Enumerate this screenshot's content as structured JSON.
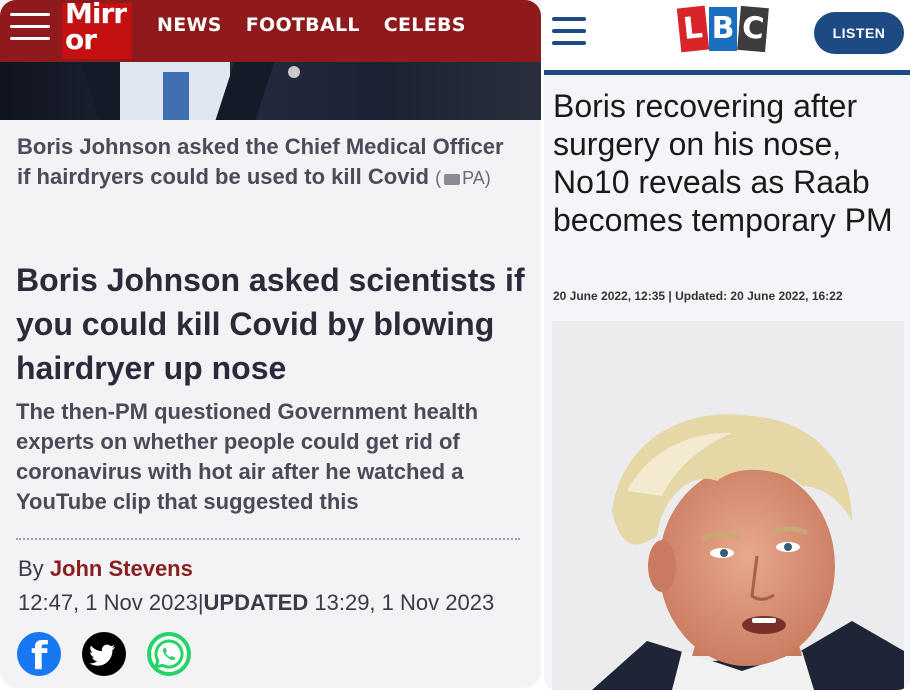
{
  "mirror": {
    "logo_text": "Mirror",
    "nav": [
      "NEWS",
      "FOOTBALL",
      "CELEBS"
    ],
    "caption": "Boris Johnson asked the Chief Medical Officer if hairdryers could be used to kill Covid",
    "caption_credit": "PA",
    "headline": "Boris Johnson asked scientists if you could kill Covid by blowing hairdryer up nose",
    "standfirst": "The then-PM questioned Government health experts on whether people could get rid of coronavirus with hot air after he watched a YouTube clip that suggested this",
    "byline_prefix": "By",
    "author": "John Stevens",
    "published": "12:47, 1 Nov 2023",
    "separator": "|",
    "updated_label": "UPDATED",
    "updated": "13:29, 1 Nov 2023",
    "share_icons": [
      "facebook-icon",
      "twitter-icon",
      "whatsapp-icon"
    ],
    "colors": {
      "brand": "#c41010",
      "header": "#8e1a1c",
      "author": "#8a1f1f"
    }
  },
  "lbc": {
    "logo_letters": [
      "L",
      "B",
      "C"
    ],
    "listen_label": "LISTEN",
    "headline": "Boris recovering after surgery on his nose, No10 reveals as Raab becomes temporary PM",
    "dateline": "20 June 2022, 12:35 | Updated: 20 June 2022, 16:22",
    "colors": {
      "brand": "#1d4a82",
      "logo_l": "#d9252a",
      "logo_b": "#1b6fc1",
      "logo_c": "#3c3c3c"
    }
  }
}
